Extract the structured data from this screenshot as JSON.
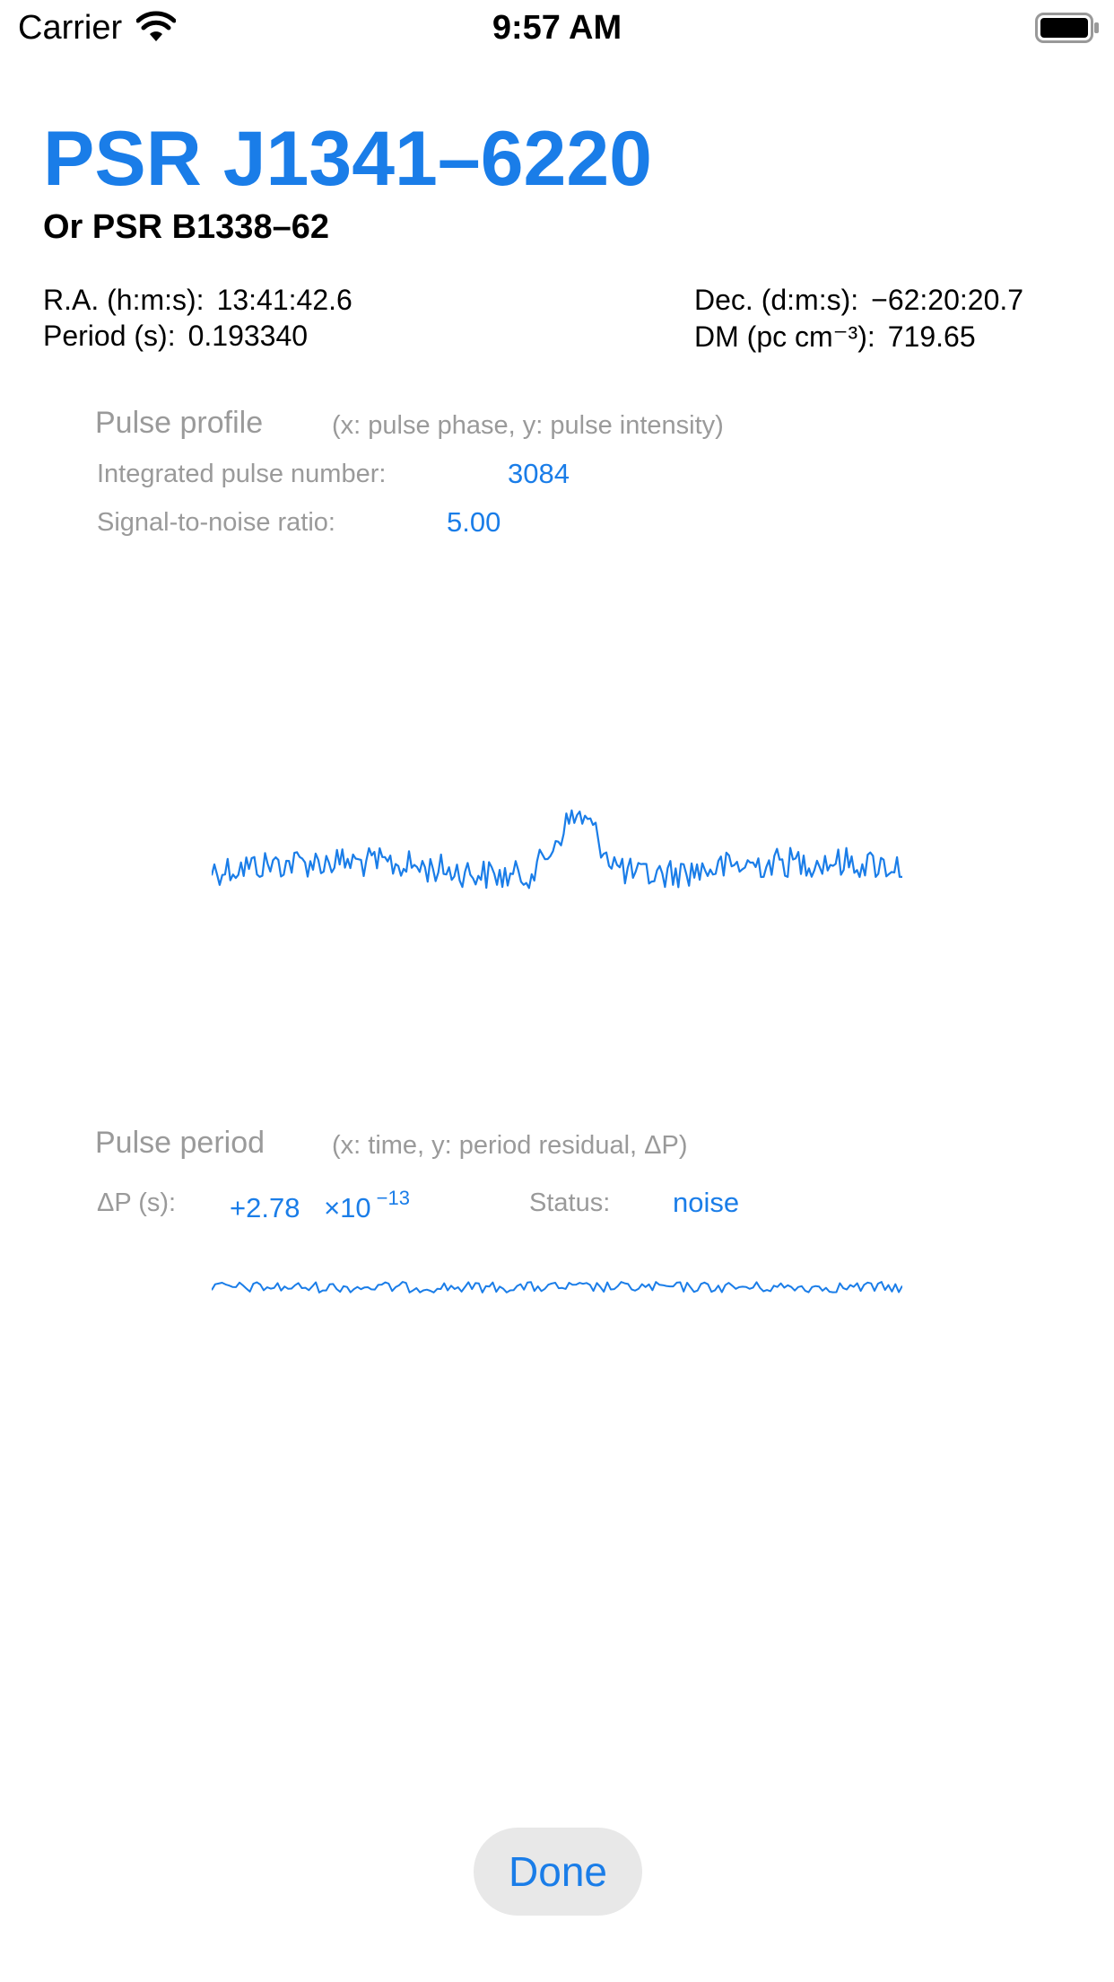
{
  "status_bar": {
    "carrier": "Carrier",
    "time": "9:57 AM",
    "icons": [
      "wifi-icon",
      "battery-icon"
    ]
  },
  "pulsar": {
    "name": "PSR J1341–6220",
    "alt_name": "Or PSR B1338–62",
    "ra_label": "R.A. (h:m:s):",
    "ra_value": "13:41:42.6",
    "period_label": "Period (s):",
    "period_value": "0.193340",
    "dec_label": "Dec. (d:m:s):",
    "dec_value": "−62:20:20.7",
    "dm_label": "DM (pc cm⁻³):",
    "dm_value": "719.65"
  },
  "pulse_profile": {
    "title": "Pulse profile",
    "note": "(x: pulse phase, y: pulse intensity)",
    "integrated_label": "Integrated pulse number:",
    "integrated_value": "3084",
    "snr_label": "Signal-to-noise ratio:",
    "snr_value": "5.00"
  },
  "pulse_period": {
    "title": "Pulse period",
    "note": "(x: time, y: period residual, ΔP)",
    "dp_label": "ΔP (s):",
    "dp_value": "+2.78",
    "dp_times": "×10",
    "dp_exponent": "−13",
    "status_label": "Status:",
    "status_value": "noise"
  },
  "done_label": "Done",
  "colors": {
    "accent": "#1a7de8",
    "muted": "#9a9a9a",
    "button_bg": "#e8e8e8"
  }
}
